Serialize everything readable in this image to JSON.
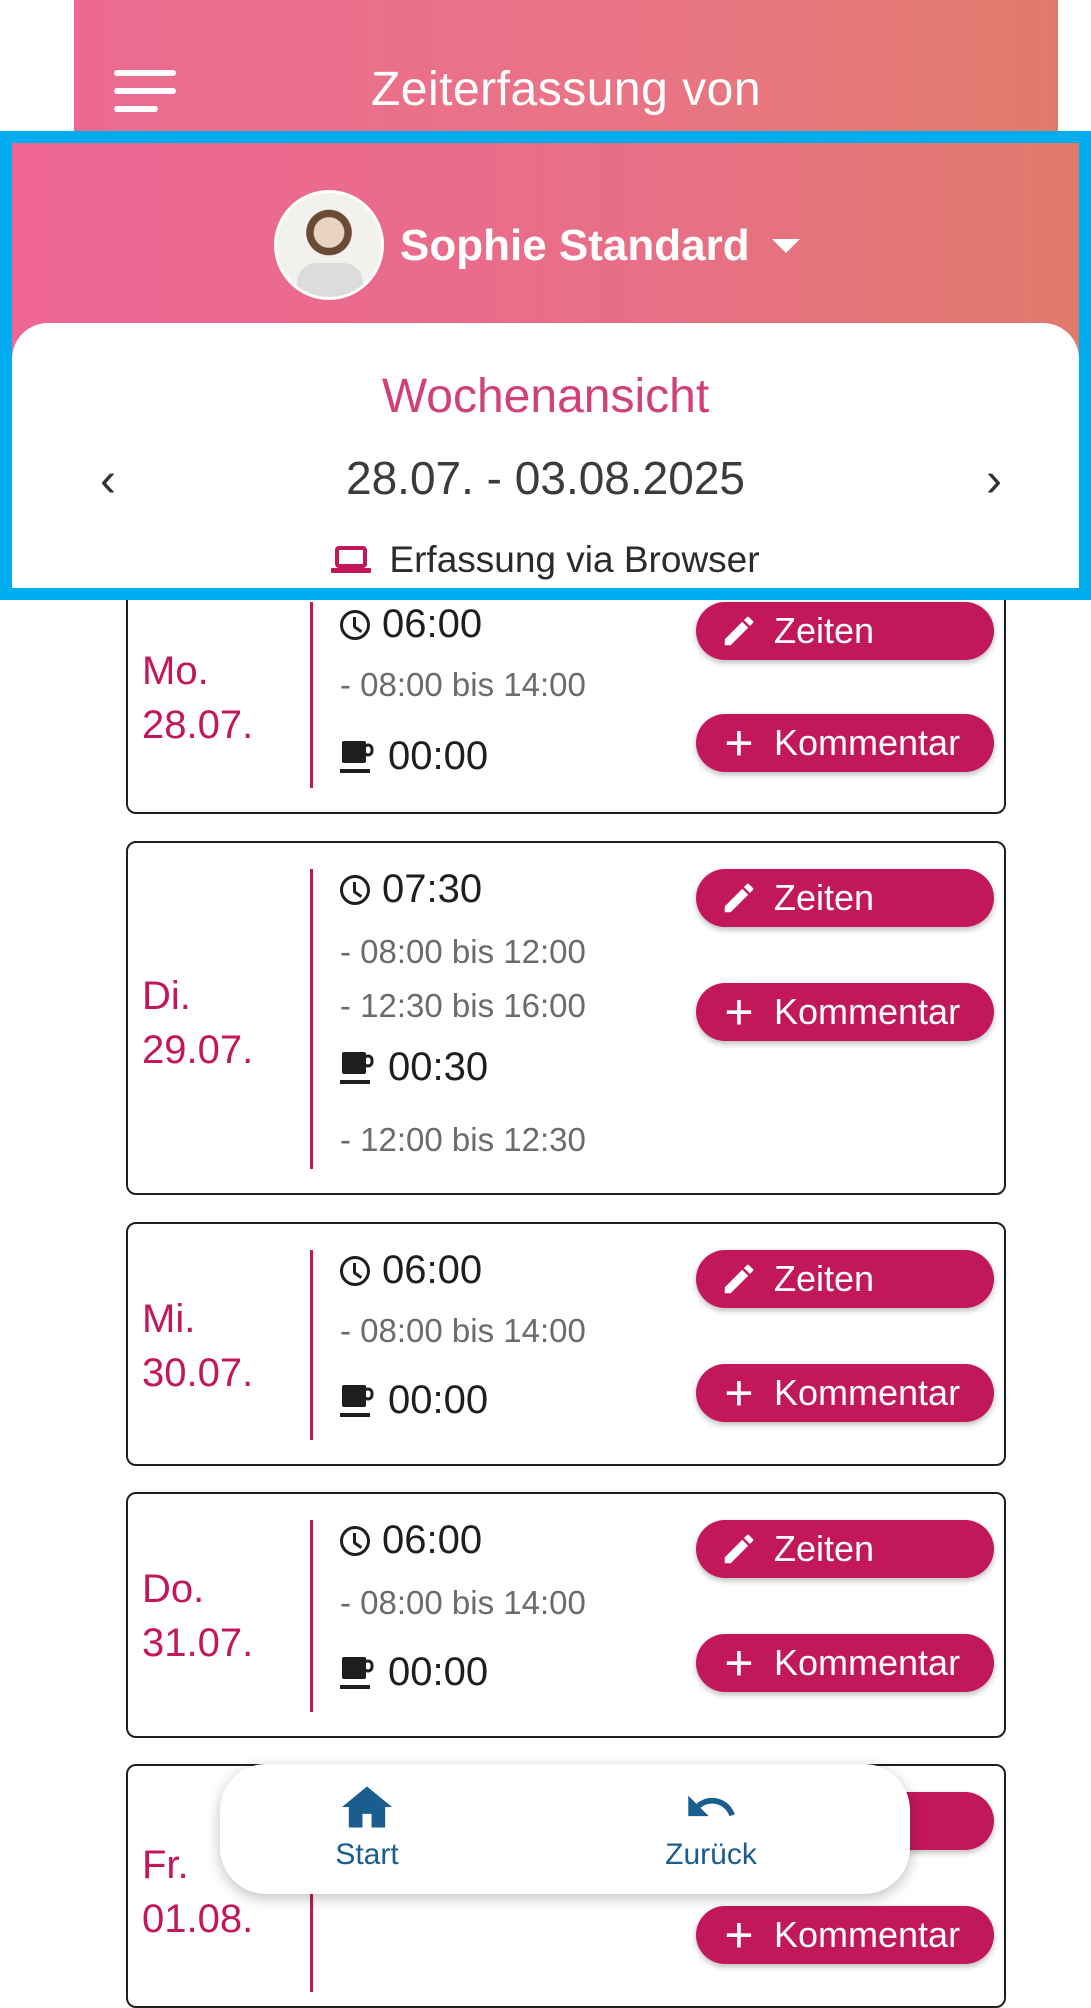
{
  "header": {
    "title": "Zeiterfassung von",
    "user_name": "Sophie Standard",
    "view_title": "Wochenansicht",
    "week_range": "28.07. - 03.08.2025",
    "source": "Erfassung via Browser",
    "prev_arrow": "‹",
    "next_arrow": "›"
  },
  "days": [
    {
      "weekday": "Mo.",
      "date": "28.07.",
      "work_total": "06:00",
      "work_ranges": [
        "- 08:00 bis 14:00"
      ],
      "break_total": "00:00",
      "break_ranges": []
    },
    {
      "weekday": "Di.",
      "date": "29.07.",
      "work_total": "07:30",
      "work_ranges": [
        "- 08:00 bis 12:00",
        "- 12:30 bis 16:00"
      ],
      "break_total": "00:30",
      "break_ranges": [
        "- 12:00 bis 12:30"
      ]
    },
    {
      "weekday": "Mi.",
      "date": "30.07.",
      "work_total": "06:00",
      "work_ranges": [
        "- 08:00 bis 14:00"
      ],
      "break_total": "00:00",
      "break_ranges": []
    },
    {
      "weekday": "Do.",
      "date": "31.07.",
      "work_total": "06:00",
      "work_ranges": [
        "- 08:00 bis 14:00"
      ],
      "break_total": "00:00",
      "break_ranges": []
    },
    {
      "weekday": "Fr.",
      "date": "01.08.",
      "work_total": "",
      "work_ranges": [],
      "break_total": "",
      "break_ranges": []
    }
  ],
  "buttons": {
    "times_label": "Zeiten",
    "comment_label": "Kommentar"
  },
  "bottom_nav": {
    "start_label": "Start",
    "back_label": "Zurück"
  },
  "colors": {
    "accent": "#c2185b",
    "highlight_border": "#00aeef",
    "nav_blue": "#1a5d8f"
  }
}
